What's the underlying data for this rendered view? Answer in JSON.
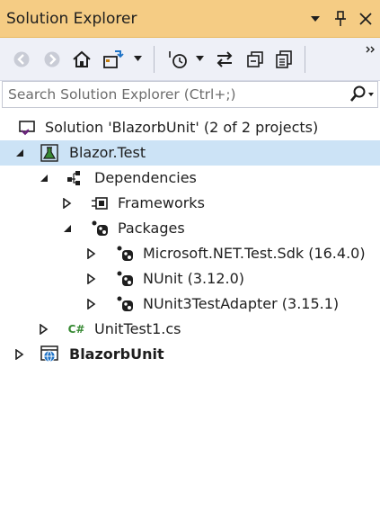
{
  "window": {
    "title": "Solution Explorer"
  },
  "search": {
    "placeholder": "Search Solution Explorer (Ctrl+;)"
  },
  "colors": {
    "titlebar": "#f5cc84",
    "toolbar": "#eef0f7",
    "selection": "#cce3f6",
    "csharp_green": "#388a34",
    "vs_purple": "#68217a"
  },
  "tree": {
    "solution": "Solution 'BlazorbUnit' (2 of 2 projects)",
    "project_test": "Blazor.Test",
    "dependencies": "Dependencies",
    "frameworks": "Frameworks",
    "packages": "Packages",
    "pkg1": "Microsoft.NET.Test.Sdk (16.4.0)",
    "pkg2": "NUnit (3.12.0)",
    "pkg3": "NUnit3TestAdapter (3.15.1)",
    "file1": "UnitTest1.cs",
    "project_main": "BlazorbUnit"
  },
  "icons": {
    "csharp_label": "C#"
  }
}
